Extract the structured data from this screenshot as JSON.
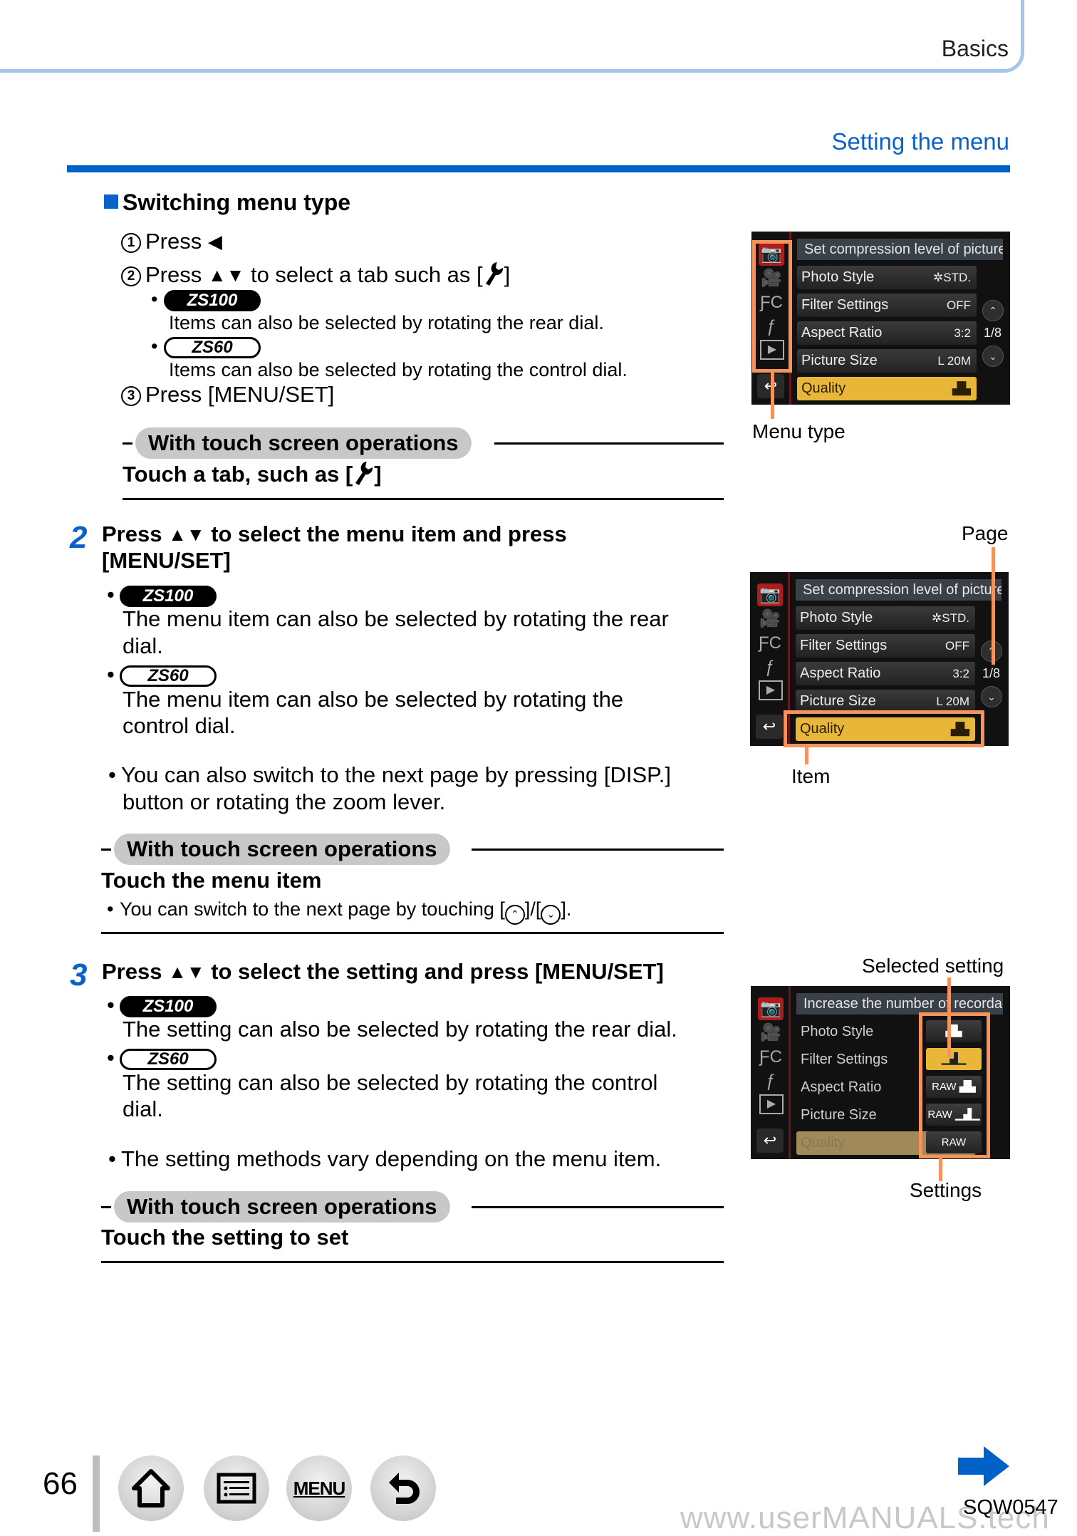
{
  "header": {
    "chapter": "Basics",
    "section_title": "Setting the menu"
  },
  "switching": {
    "heading": "Switching menu type",
    "step1": {
      "num": "1",
      "text": "Press",
      "arrow": "◀"
    },
    "step2": {
      "num": "2",
      "text_a": "Press",
      "arrows": "▲▼",
      "text_b": "to select a tab such as [",
      "text_c": "]"
    },
    "note_zs100": {
      "badge": "ZS100",
      "text": "Items can also be selected by rotating the rear dial."
    },
    "note_zs60": {
      "badge": "ZS60",
      "text": "Items can also be selected by rotating the control dial."
    },
    "step3": {
      "num": "3",
      "text": "Press [MENU/SET]"
    },
    "touch": {
      "pill": "With touch screen operations",
      "text_a": "Touch a tab, such as [",
      "text_b": "]"
    }
  },
  "step2": {
    "num": "2",
    "title_a": "Press",
    "arrows": "▲▼",
    "title_b": "to select the menu item and press",
    "title_line2": "[MENU/SET]",
    "zs100": {
      "badge": "ZS100",
      "line1": "The menu item can also be selected by rotating the rear",
      "line2": "dial."
    },
    "zs60": {
      "badge": "ZS60",
      "line1": "The menu item can also be selected by rotating the",
      "line2": "control dial."
    },
    "note": {
      "line1": "You can also switch to the next page by pressing [DISP.]",
      "line2": "button or rotating the zoom lever."
    },
    "touch": {
      "pill": "With touch screen operations",
      "title": "Touch the menu item",
      "note_a": "You can switch to the next page by touching [",
      "note_b": "]/[",
      "note_c": "]."
    }
  },
  "step3": {
    "num": "3",
    "title_a": "Press",
    "arrows": "▲▼",
    "title_b": "to select the setting and press [MENU/SET]",
    "zs100": {
      "badge": "ZS100",
      "line1": "The setting can also be selected by rotating the rear dial."
    },
    "zs60": {
      "badge": "ZS60",
      "line1": "The setting can also be selected by rotating the control",
      "line2": "dial."
    },
    "note": "The setting methods vary depending on the menu item.",
    "touch": {
      "pill": "With touch screen operations",
      "title": "Touch the setting to set"
    }
  },
  "screens": {
    "menu_items": [
      {
        "label": "Photo Style",
        "value": "✲STD."
      },
      {
        "label": "Filter Settings",
        "value": "OFF"
      },
      {
        "label": "Aspect Ratio",
        "value": "3:2"
      },
      {
        "label": "Picture Size",
        "value": "L 20M"
      },
      {
        "label": "Quality",
        "value": "▟▙"
      }
    ],
    "screen1": {
      "description": "Set compression level of picture",
      "page": "1/8",
      "callout": "Menu type"
    },
    "screen2": {
      "description": "Set compression level of picture",
      "page": "1/8",
      "callout_page": "Page",
      "callout_item": "Item"
    },
    "screen3": {
      "description": "Increase the number of recordable",
      "settings": [
        "▟▙",
        "▁▟▁",
        "RAW ▟▙",
        "RAW ▁▟▁",
        "RAW"
      ],
      "selected_index": 1,
      "callout_selected": "Selected setting",
      "callout_settings": "Settings"
    },
    "tab_icons": [
      "camera-icon",
      "video-camera-icon",
      "custom-wrench-icon",
      "wrench-icon",
      "playback-icon"
    ]
  },
  "footer": {
    "page_number": "66",
    "nav_buttons": [
      {
        "name": "home",
        "label": ""
      },
      {
        "name": "contents",
        "label": ""
      },
      {
        "name": "menu",
        "label": "MENU"
      },
      {
        "name": "back",
        "label": ""
      }
    ],
    "doc_code": "SQW0547",
    "watermark": "www.userMANUALS.tech"
  },
  "colors": {
    "accent_blue": "#0062c8",
    "header_tab": "#a8c4e8",
    "callout_orange": "#f4945c",
    "selected_yellow": "#e8b73a"
  }
}
